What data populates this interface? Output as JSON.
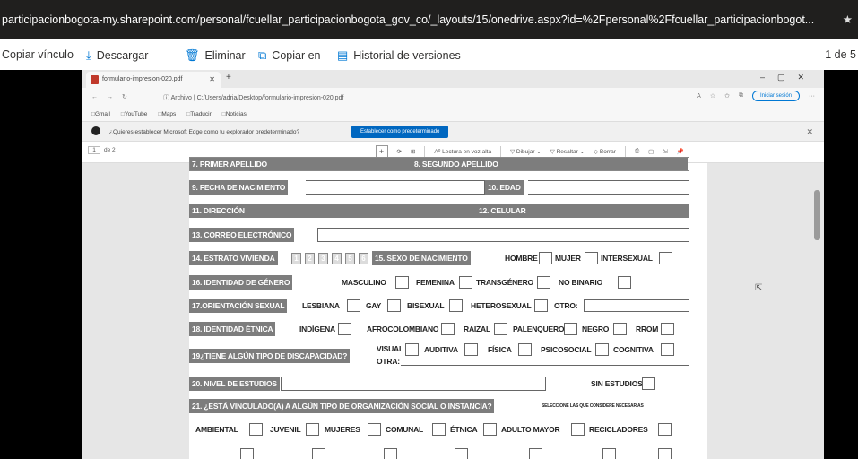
{
  "browser": {
    "url": "participacionbogota-my.sharepoint.com/personal/fcuellar_participacionbogota_gov_co/_layouts/15/onedrive.aspx?id=%2Fpersonal%2Ffcuellar_participacionbogot...",
    "star_icon": "star-icon"
  },
  "sharepoint_toolbar": {
    "copy_link": "Copiar vínculo",
    "download": "Descargar",
    "delete": "Eliminar",
    "copy_to": "Copiar en",
    "version_history": "Historial de versiones",
    "page_indicator": "1 de 5"
  },
  "edge": {
    "tab_title": "formulario-impresion-020.pdf",
    "archive_label": "Archivo",
    "address": "C:/Users/adria/Desktop/formulario-impresion-020.pdf",
    "sign_in": "Iniciar sesión",
    "bookmarks": [
      "Gmail",
      "YouTube",
      "Maps",
      "Traducir",
      "Noticias"
    ],
    "default_prompt": "¿Quieres establecer Microsoft Edge como tu explorador predeterminado?",
    "default_button": "Establecer como predeterminado",
    "pdf_page": "1",
    "pdf_page_total": "de 2",
    "tools": {
      "read_aloud": "Lectura en voz alta",
      "draw": "Dibujar",
      "highlight": "Resaltar",
      "erase": "Borrar"
    }
  },
  "form": {
    "f7": "7. PRIMER APELLIDO",
    "f8": "8. SEGUNDO APELLIDO",
    "f9": "9. FECHA DE NACIMIENTO",
    "f10": "10. EDAD",
    "f11": "11. DIRECCIÓN",
    "f12": "12. CELULAR",
    "f13": "13. CORREO ELECTRÓNICO",
    "f14": "14. ESTRATO VIVIENDA",
    "estratos": [
      "1",
      "2",
      "3",
      "4",
      "5",
      "6"
    ],
    "f15": "15. SEXO DE NACIMIENTO",
    "sexo": [
      "HOMBRE",
      "MUJER",
      "INTERSEXUAL"
    ],
    "f16": "16. IDENTIDAD DE GÉNERO",
    "genero": [
      "MASCULINO",
      "FEMENINA",
      "TRANSGÉNERO",
      "NO BINARIO"
    ],
    "f17": "17.ORIENTACIÓN SEXUAL",
    "orientacion": [
      "LESBIANA",
      "GAY",
      "BISEXUAL",
      "HETEROSEXUAL",
      "OTRO:"
    ],
    "f18": "18. IDENTIDAD ÉTNICA",
    "etnica": [
      "INDÍGENA",
      "AFROCOLOMBIANO",
      "RAIZAL",
      "PALENQUERO",
      "NEGRO",
      "RROM"
    ],
    "f19": "19¿TIENE ALGÚN TIPO DE DISCAPACIDAD?",
    "discapacidad": [
      "VISUAL",
      "AUDITIVA",
      "FÍSICA",
      "PSICOSOCIAL",
      "COGNITIVA"
    ],
    "otra": "OTRA:",
    "f20": "20. NIVEL DE ESTUDIOS",
    "sin_estudios": "SIN ESTUDIOS",
    "f21": "21. ¿ESTÁ VINCULADO(A) A ALGÚN TIPO DE ORGANIZACIÓN SOCIAL O INSTANCIA?",
    "f21_hint": "SELECCIONE LAS QUE CONSIDERE NECESARIAS",
    "organizaciones": [
      "AMBIENTAL",
      "JUVENIL",
      "MUJERES",
      "COMUNAL",
      "ÉTNICA",
      "ADULTO MAYOR",
      "RECICLADORES"
    ]
  }
}
